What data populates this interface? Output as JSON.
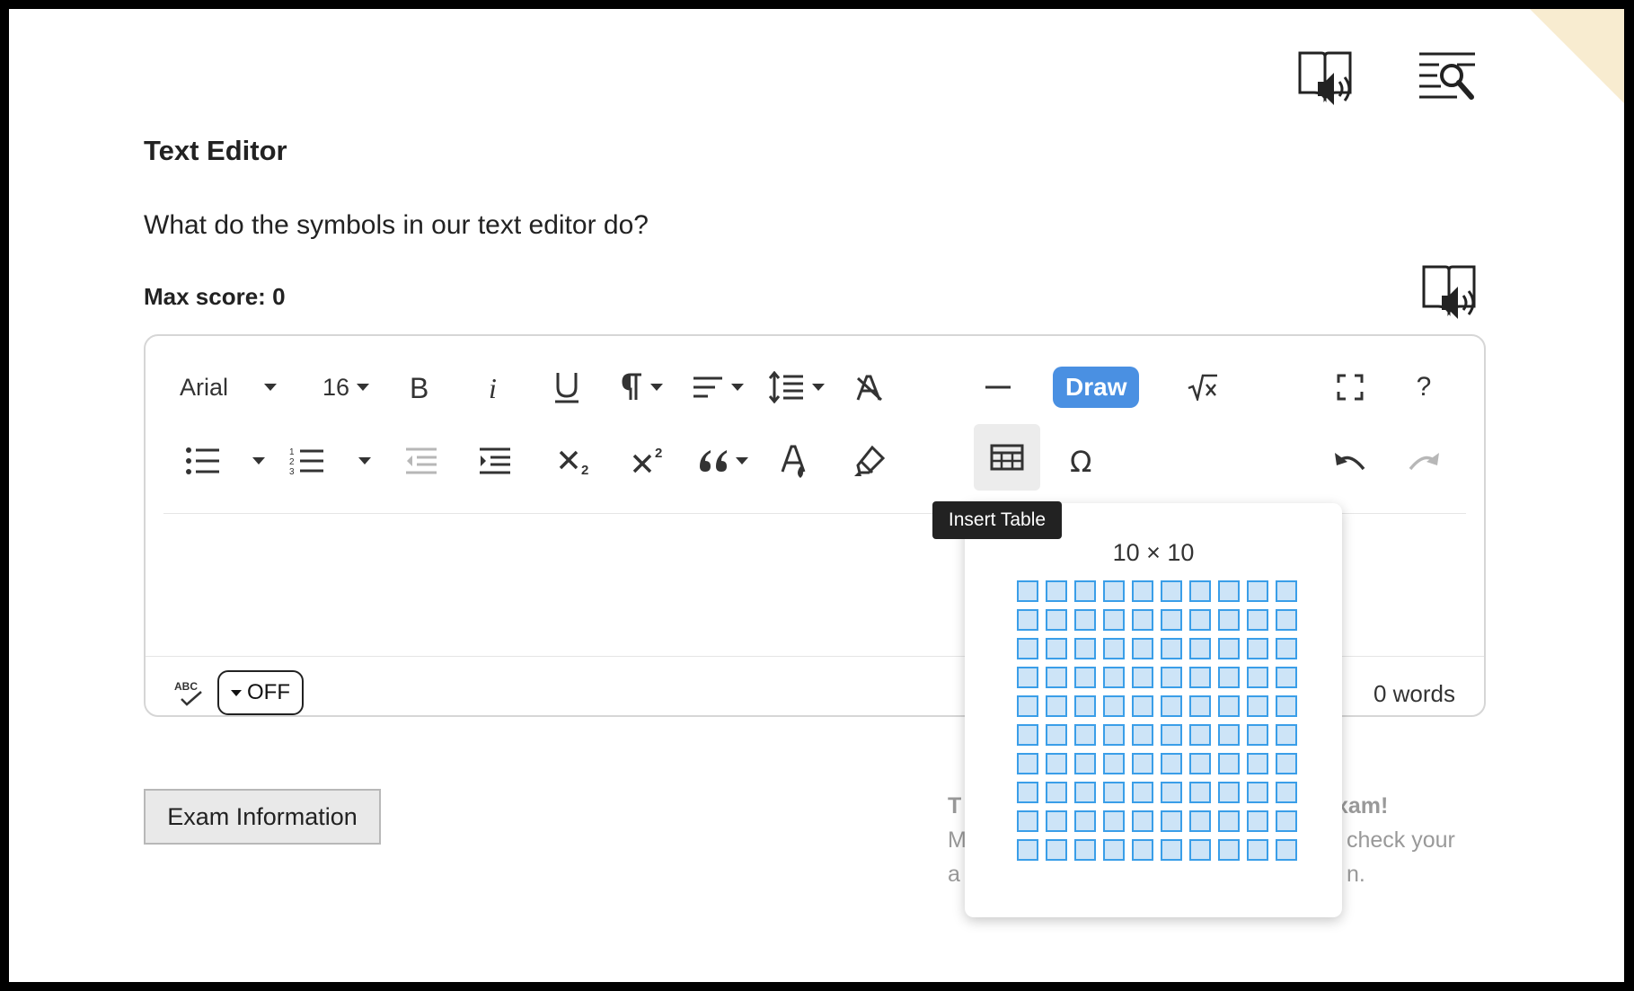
{
  "header": {
    "reader_icon": "book-speaker-icon",
    "search_icon": "text-search-icon"
  },
  "question": {
    "title": "Text Editor",
    "prompt": "What do the symbols in our text editor do?",
    "max_score": "Max score: 0",
    "reader_icon": "book-speaker-icon"
  },
  "editor": {
    "toolbar_row1": {
      "font_family": "Arial",
      "font_size": "16",
      "draw_label": "Draw",
      "help_label": "?"
    },
    "spellcheck_state": "OFF",
    "word_count": "0 words"
  },
  "table_picker": {
    "tooltip": "Insert Table",
    "size_label": "10 × 10",
    "rows": 10,
    "cols": 10
  },
  "footer": {
    "exam_info_label": "Exam Information",
    "notice_line1": "T",
    "notice_line1_end": "xam!",
    "notice_line2_start": "M",
    "notice_line2_end": "check your",
    "notice_line3_start": "a",
    "notice_line3_end": "n."
  },
  "colors": {
    "accent": "#4a90e2",
    "grid_fill": "#cde4f7",
    "grid_border": "#3a9ee8",
    "corner": "#f8ecd0"
  }
}
